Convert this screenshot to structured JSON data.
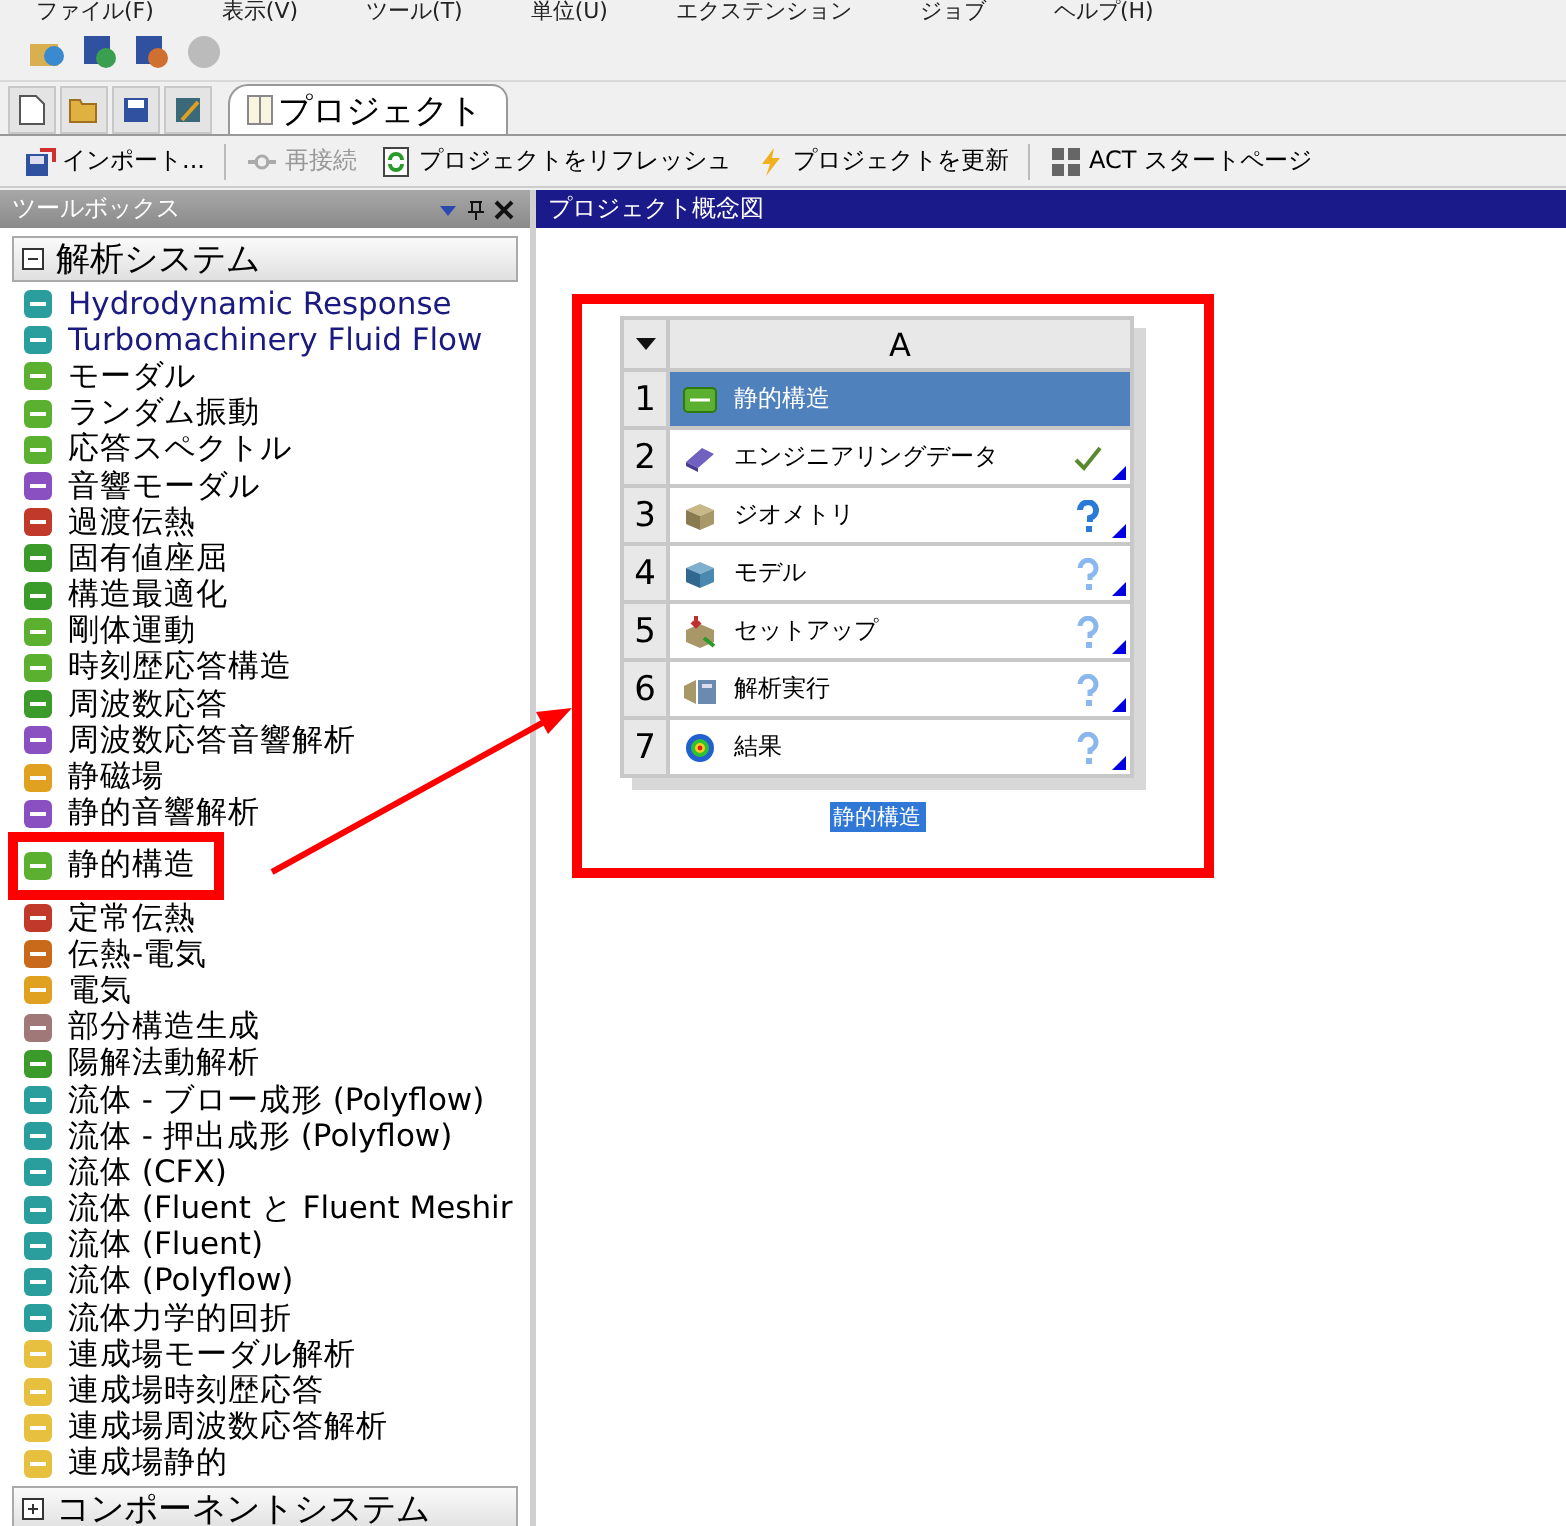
{
  "menu": [
    "ファイル(F)",
    "表示(V)",
    "ツール(T)",
    "単位(U)",
    "エクステンション",
    "ジョブ",
    "ヘルプ(H)"
  ],
  "file_tabs": [
    {
      "label": "プロジェクト",
      "selected": true
    }
  ],
  "action_toolbar": [
    {
      "kind": "import",
      "label": "インポート...",
      "disabled": false
    },
    {
      "kind": "reconnect",
      "label": "再接続",
      "disabled": true
    },
    {
      "kind": "refresh",
      "label": "プロジェクトをリフレッシュ",
      "disabled": false
    },
    {
      "kind": "update",
      "label": "プロジェクトを更新",
      "disabled": false
    },
    {
      "kind": "act",
      "label": "ACT スタートページ",
      "disabled": false
    }
  ],
  "toolbox": {
    "title": "ツールボックス",
    "groups": [
      {
        "label": "解析システム",
        "expanded": true,
        "items": [
          {
            "label": "Hydrodynamic Response",
            "kind": "extension",
            "color": "#2a9d9d"
          },
          {
            "label": "Turbomachinery Fluid Flow",
            "kind": "extension",
            "color": "#2a9d9d"
          },
          {
            "label": "モーダル",
            "kind": "builtin",
            "color": "#5cb030"
          },
          {
            "label": "ランダム振動",
            "kind": "builtin",
            "color": "#5cb030"
          },
          {
            "label": "応答スペクトル",
            "kind": "builtin",
            "color": "#5cb030"
          },
          {
            "label": "音響モーダル",
            "kind": "builtin",
            "color": "#8a4fc0"
          },
          {
            "label": "過渡伝熱",
            "kind": "builtin",
            "color": "#c0392b"
          },
          {
            "label": "固有値座屈",
            "kind": "builtin",
            "color": "#3a9a2a"
          },
          {
            "label": "構造最適化",
            "kind": "builtin",
            "color": "#3a9a2a"
          },
          {
            "label": "剛体運動",
            "kind": "builtin",
            "color": "#5cb030"
          },
          {
            "label": "時刻歴応答構造",
            "kind": "builtin",
            "color": "#5cb030"
          },
          {
            "label": "周波数応答",
            "kind": "builtin",
            "color": "#3a9a2a"
          },
          {
            "label": "周波数応答音響解析",
            "kind": "builtin",
            "color": "#8a4fc0"
          },
          {
            "label": "静磁場",
            "kind": "builtin",
            "color": "#e0a020"
          },
          {
            "label": "静的音響解析",
            "kind": "builtin",
            "color": "#8a4fc0"
          },
          {
            "label": "静的構造",
            "kind": "builtin",
            "color": "#5cb030",
            "highlighted": true
          },
          {
            "label": "定常伝熱",
            "kind": "builtin",
            "color": "#c0392b"
          },
          {
            "label": "伝熱-電気",
            "kind": "builtin",
            "color": "#c86a1a"
          },
          {
            "label": "電気",
            "kind": "builtin",
            "color": "#e0a020"
          },
          {
            "label": "部分構造生成",
            "kind": "builtin",
            "color": "#a07878"
          },
          {
            "label": "陽解法動解析",
            "kind": "builtin",
            "color": "#3a9a2a"
          },
          {
            "label": "流体 - ブロー成形 (Polyflow)",
            "kind": "builtin",
            "color": "#2a9d9d"
          },
          {
            "label": "流体 - 押出成形 (Polyflow)",
            "kind": "builtin",
            "color": "#2a9d9d"
          },
          {
            "label": "流体 (CFX)",
            "kind": "builtin",
            "color": "#2a9d9d"
          },
          {
            "label": "流体 (Fluent と Fluent Meshir",
            "kind": "builtin",
            "color": "#2a9d9d"
          },
          {
            "label": "流体 (Fluent)",
            "kind": "builtin",
            "color": "#2a9d9d"
          },
          {
            "label": "流体 (Polyflow)",
            "kind": "builtin",
            "color": "#2a9d9d"
          },
          {
            "label": "流体力学的回折",
            "kind": "builtin",
            "color": "#2a9d9d"
          },
          {
            "label": "連成場モーダル解析",
            "kind": "builtin",
            "color": "#e8c040"
          },
          {
            "label": "連成場時刻歴応答",
            "kind": "builtin",
            "color": "#e8c040"
          },
          {
            "label": "連成場周波数応答解析",
            "kind": "builtin",
            "color": "#e8c040"
          },
          {
            "label": "連成場静的",
            "kind": "builtin",
            "color": "#e8c040"
          }
        ]
      },
      {
        "label": "コンポーネントシステム",
        "expanded": false
      }
    ]
  },
  "schematic": {
    "title": "プロジェクト概念図",
    "system": {
      "column": "A",
      "caption": "静的構造",
      "rows": [
        {
          "number": "1",
          "kind": "system",
          "label": "静的構造",
          "selected": true
        },
        {
          "number": "2",
          "kind": "engineering-data",
          "label": "エンジニアリングデータ",
          "selected": false,
          "complete": true,
          "needs_input": false
        },
        {
          "number": "3",
          "kind": "geometry",
          "label": "ジオメトリ",
          "selected": false,
          "complete": false,
          "needs_input": true
        },
        {
          "number": "4",
          "kind": "model",
          "label": "モデル",
          "selected": false,
          "complete": false,
          "needs_input": false
        },
        {
          "number": "5",
          "kind": "setup",
          "label": "セットアップ",
          "selected": false,
          "complete": false,
          "needs_input": false
        },
        {
          "number": "6",
          "kind": "solution",
          "label": "解析実行",
          "selected": false,
          "complete": false,
          "needs_input": false
        },
        {
          "number": "7",
          "kind": "results",
          "label": "結果",
          "selected": false,
          "complete": false,
          "needs_input": false
        }
      ]
    }
  }
}
